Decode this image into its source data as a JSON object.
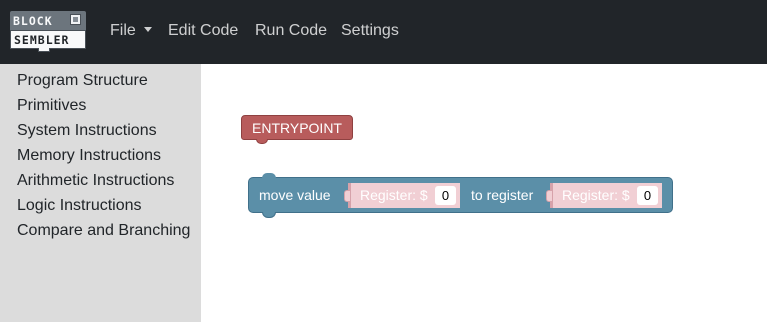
{
  "app": {
    "logo_top": "BLOCK",
    "logo_bottom": "SEMBLER"
  },
  "navbar": {
    "items": [
      {
        "label": "File",
        "has_dropdown": true
      },
      {
        "label": "Edit Code"
      },
      {
        "label": "Run Code"
      },
      {
        "label": "Settings"
      }
    ]
  },
  "sidebar": {
    "items": [
      {
        "label": "Program Structure"
      },
      {
        "label": "Primitives"
      },
      {
        "label": "System Instructions"
      },
      {
        "label": "Memory Instructions"
      },
      {
        "label": "Arithmetic Instructions"
      },
      {
        "label": "Logic Instructions"
      },
      {
        "label": "Compare and Branching"
      }
    ]
  },
  "workspace": {
    "entry_block": {
      "label": "ENTRYPOINT",
      "color": "#b85c5c"
    },
    "move_block": {
      "label": "move value",
      "color": "#5b8fa8",
      "source": {
        "label": "Register: $",
        "value": "0"
      },
      "to_label": "to register",
      "dest": {
        "label": "Register: $",
        "value": "0"
      }
    }
  },
  "colors": {
    "navbar": "#212529",
    "sidebar": "#dcdcdc",
    "register_block": "#f1cfd4"
  }
}
